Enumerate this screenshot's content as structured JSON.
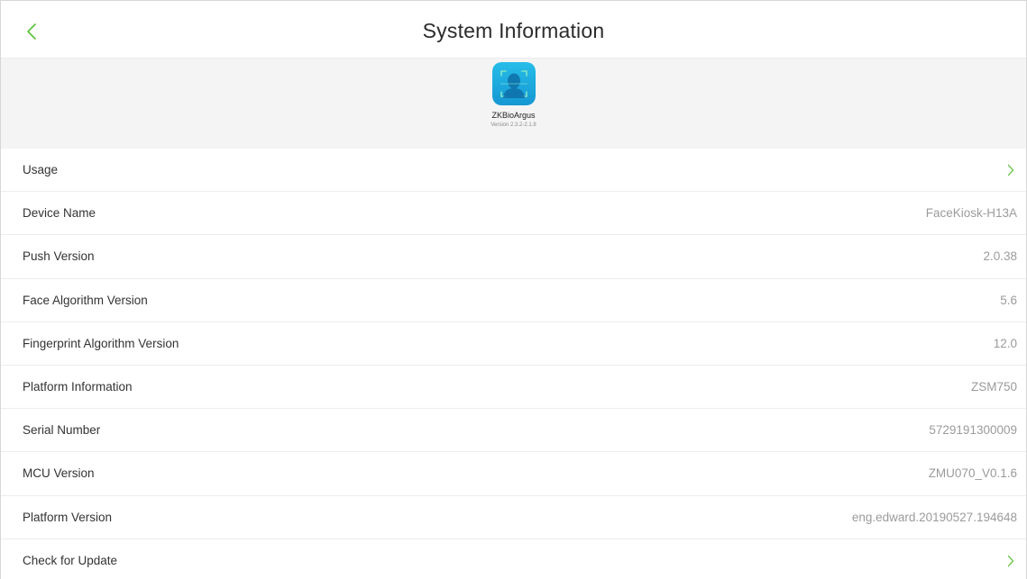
{
  "header": {
    "title": "System Information",
    "back_icon": "chevron-left-icon",
    "accent_color": "#5cbf3a"
  },
  "app": {
    "name": "ZKBioArgus",
    "version": "Version 2.3.2-2.1.8",
    "icon": "face-scan-icon",
    "icon_color": "#19aee0"
  },
  "rows": [
    {
      "label": "Usage",
      "value": "",
      "action": "chevron-right-icon"
    },
    {
      "label": "Device Name",
      "value": "FaceKiosk-H13A"
    },
    {
      "label": "Push Version",
      "value": "2.0.38"
    },
    {
      "label": "Face Algorithm Version",
      "value": "5.6"
    },
    {
      "label": "Fingerprint Algorithm Version",
      "value": "12.0"
    },
    {
      "label": "Platform Information",
      "value": "ZSM750"
    },
    {
      "label": "Serial Number",
      "value": "5729191300009"
    },
    {
      "label": "MCU Version",
      "value": "ZMU070_V0.1.6"
    },
    {
      "label": "Platform Version",
      "value": "eng.edward.20190527.194648"
    },
    {
      "label": "Check for Update",
      "value": "",
      "action": "chevron-right-icon"
    }
  ]
}
